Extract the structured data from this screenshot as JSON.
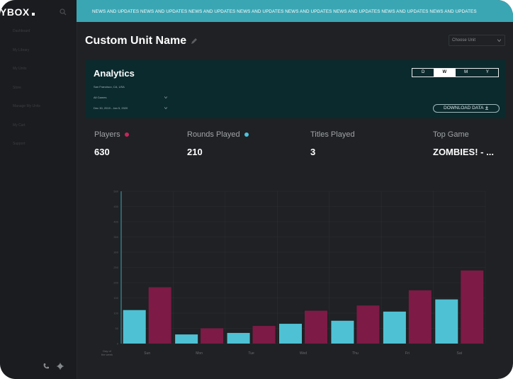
{
  "sidebar": {
    "logo": "YBOX",
    "items": [
      "Dashboard",
      "My Library",
      "My Units",
      "Store",
      "Manage My Units",
      "My Cart",
      "Support"
    ]
  },
  "topbar": {
    "ticker": "NEWS AND UPDATES NEWS AND UPDATES NEWS AND UPDATES NEWS AND UPDATES NEWS AND UPDATES NEWS AND UPDATES NEWS AND UPDATES NEWS AND UPDATES"
  },
  "header": {
    "title": "Custom Unit Name",
    "unit_select": "Choose Unit"
  },
  "analytics": {
    "title": "Analytics",
    "location": "San Francisco, CA, USA",
    "games_filter": "All Games",
    "date_range": "Dec 30, 2019 - Jan 5, 2020",
    "ranges": [
      "D",
      "W",
      "M",
      "Y"
    ],
    "active_range": "W",
    "download_label": "DOWNLOAD DATA"
  },
  "stats": [
    {
      "label": "Players",
      "value": "630",
      "dot_color": "#c4275a"
    },
    {
      "label": "Rounds Played",
      "value": "210",
      "dot_color": "#4cc3dc"
    },
    {
      "label": "Titles Played",
      "value": "3"
    },
    {
      "label": "Top Game",
      "value": "ZOMBIES! - ..."
    }
  ],
  "chart_data": {
    "type": "bar",
    "categories": [
      "Sun",
      "Mon",
      "Tue",
      "Wed",
      "Thu",
      "Fri",
      "Sat"
    ],
    "series": [
      {
        "values": [
          110,
          30,
          35,
          65,
          75,
          105,
          145
        ],
        "color": "#4fc1d4"
      },
      {
        "values": [
          185,
          50,
          58,
          108,
          125,
          175,
          240
        ],
        "color": "#7d1a45"
      }
    ],
    "ylim": [
      0,
      500
    ],
    "y_ticks": [
      0,
      50,
      100,
      150,
      200,
      250,
      300,
      350,
      400,
      450,
      500
    ],
    "xlabel": "Day of the week",
    "grid": true
  },
  "colors": {
    "accent": "#3ba6b3",
    "players": "#c4275a",
    "rounds": "#4cc3dc",
    "panel": "#0b2a2e"
  }
}
